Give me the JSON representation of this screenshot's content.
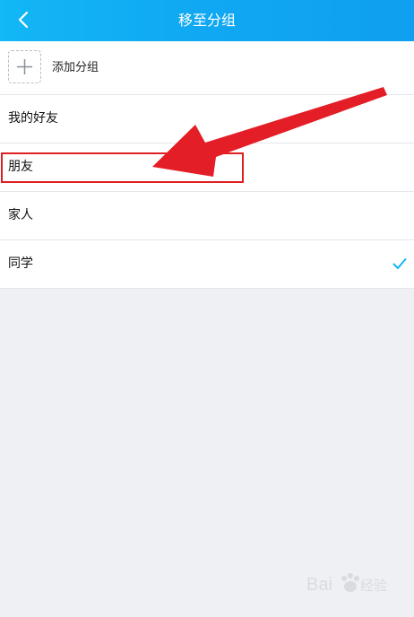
{
  "header": {
    "title": "移至分组",
    "back_icon": "chevron-left-icon"
  },
  "add_group": {
    "label": "添加分组",
    "icon": "plus-icon"
  },
  "groups": [
    {
      "label": "我的好友",
      "selected": false
    },
    {
      "label": "朋友",
      "selected": false
    },
    {
      "label": "家人",
      "selected": false
    },
    {
      "label": "同学",
      "selected": true
    }
  ],
  "annotation": {
    "color": "#e02020",
    "highlighted_item": "朋友"
  },
  "watermark": {
    "text": "Bai经验"
  },
  "colors": {
    "header": "#12b7f5",
    "checkmark": "#12b7f5",
    "background": "#eef0f4"
  }
}
